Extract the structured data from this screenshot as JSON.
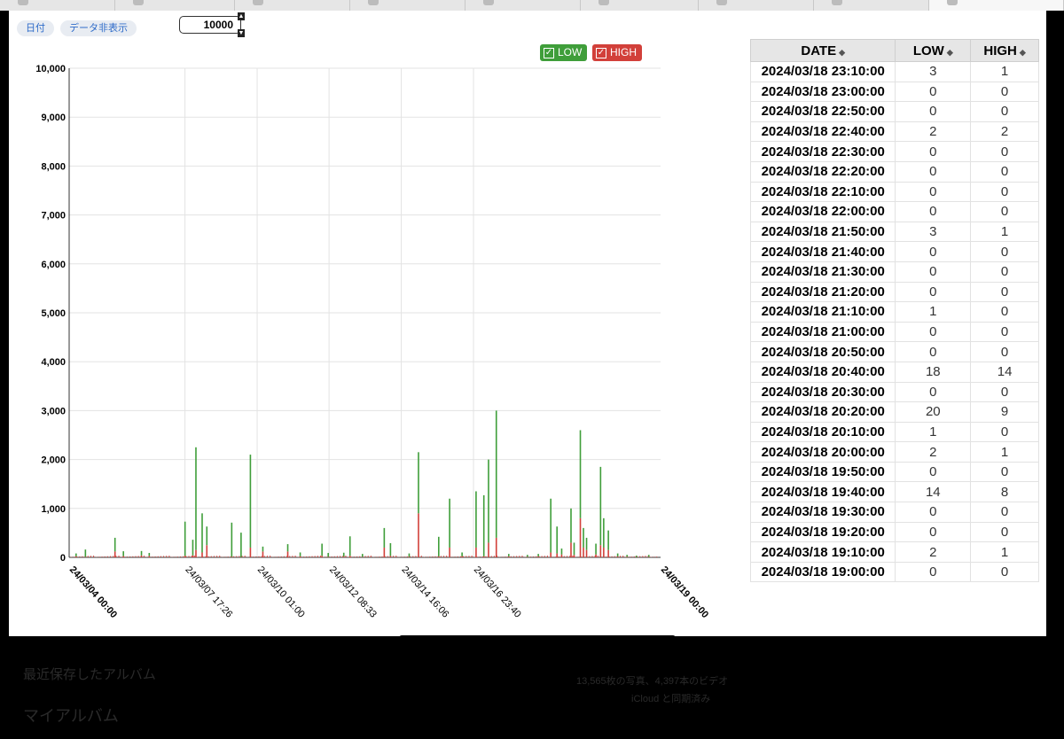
{
  "toolbar": {
    "date_button": "日付",
    "hide_data_button": "データ非表示",
    "max_value": "10000",
    "spin_up": "▲",
    "spin_down": "▼"
  },
  "legend": {
    "low_label": "LOW",
    "high_label": "HIGH",
    "low_color": "#3f9e3a",
    "high_color": "#d2403a",
    "check_glyph": "✓"
  },
  "chart_data": {
    "type": "bar",
    "stacked": true,
    "ylim": [
      0,
      10000
    ],
    "yticks": [
      "0",
      "1,000",
      "2,000",
      "3,000",
      "4,000",
      "5,000",
      "6,000",
      "7,000",
      "8,000",
      "9,000",
      "10,000"
    ],
    "xticks": [
      "24/03/04 00:00",
      "24/03/07 17:26",
      "24/03/10 01:00",
      "24/03/12 08:33",
      "24/03/14 16:06",
      "24/03/16 23:40",
      "24/03/19 00:00"
    ],
    "grid": true,
    "series": [
      {
        "name": "HIGH",
        "color": "#d2403a",
        "x": [
          0.2,
          0.5,
          1.45,
          1.72,
          2.3,
          2.55,
          3.7,
          3.95,
          4.05,
          4.25,
          4.4,
          5.2,
          5.5,
          5.8,
          6.2,
          7.0,
          7.4,
          8.1,
          8.3,
          8.8,
          9.0,
          9.4,
          10.1,
          10.3,
          10.9,
          11.2,
          11.85,
          12.2,
          12.6,
          13.05,
          13.3,
          13.45,
          13.7,
          14.1,
          14.7,
          15.05,
          15.45,
          15.65,
          15.8,
          16.1,
          16.2,
          16.4,
          16.5,
          16.6,
          16.9,
          17.05,
          17.15,
          17.3,
          17.6,
          17.9,
          18.2,
          18.6
        ],
        "y": [
          20,
          10,
          120,
          25,
          40,
          30,
          30,
          40,
          150,
          100,
          250,
          10,
          5,
          200,
          120,
          120,
          20,
          30,
          10,
          15,
          30,
          10,
          200,
          30,
          10,
          900,
          20,
          200,
          20,
          200,
          20,
          300,
          400,
          20,
          10,
          20,
          100,
          80,
          60,
          300,
          50,
          800,
          200,
          150,
          60,
          250,
          200,
          150,
          20,
          10,
          5,
          10
        ]
      },
      {
        "name": "LOW",
        "color": "#3f9e3a",
        "x": [
          0.2,
          0.5,
          1.45,
          1.72,
          2.3,
          2.55,
          3.7,
          3.95,
          4.05,
          4.25,
          4.4,
          5.2,
          5.5,
          5.8,
          6.2,
          7.0,
          7.4,
          8.1,
          8.3,
          8.8,
          9.0,
          9.4,
          10.1,
          10.3,
          10.9,
          11.2,
          11.85,
          12.2,
          12.6,
          13.05,
          13.3,
          13.45,
          13.7,
          14.1,
          14.7,
          15.05,
          15.45,
          15.65,
          15.8,
          16.1,
          16.2,
          16.4,
          16.5,
          16.6,
          16.9,
          17.05,
          17.15,
          17.3,
          17.6,
          17.9,
          18.2,
          18.6
        ],
        "y": [
          60,
          150,
          280,
          100,
          90,
          60,
          700,
          320,
          2100,
          800,
          380,
          700,
          500,
          1900,
          100,
          150,
          80,
          250,
          80,
          80,
          400,
          60,
          400,
          260,
          70,
          1250,
          400,
          1000,
          80,
          1150,
          1250,
          1700,
          2600,
          50,
          40,
          50,
          1100,
          550,
          120,
          700,
          250,
          1800,
          400,
          250,
          220,
          1600,
          600,
          400,
          60,
          40,
          30,
          40
        ]
      }
    ]
  },
  "table": {
    "headers": [
      "DATE",
      "LOW",
      "HIGH"
    ],
    "sort_glyph": "◆",
    "rows": [
      [
        "2024/03/18 23:10:00",
        "3",
        "1"
      ],
      [
        "2024/03/18 23:00:00",
        "0",
        "0"
      ],
      [
        "2024/03/18 22:50:00",
        "0",
        "0"
      ],
      [
        "2024/03/18 22:40:00",
        "2",
        "2"
      ],
      [
        "2024/03/18 22:30:00",
        "0",
        "0"
      ],
      [
        "2024/03/18 22:20:00",
        "0",
        "0"
      ],
      [
        "2024/03/18 22:10:00",
        "0",
        "0"
      ],
      [
        "2024/03/18 22:00:00",
        "0",
        "0"
      ],
      [
        "2024/03/18 21:50:00",
        "3",
        "1"
      ],
      [
        "2024/03/18 21:40:00",
        "0",
        "0"
      ],
      [
        "2024/03/18 21:30:00",
        "0",
        "0"
      ],
      [
        "2024/03/18 21:20:00",
        "0",
        "0"
      ],
      [
        "2024/03/18 21:10:00",
        "1",
        "0"
      ],
      [
        "2024/03/18 21:00:00",
        "0",
        "0"
      ],
      [
        "2024/03/18 20:50:00",
        "0",
        "0"
      ],
      [
        "2024/03/18 20:40:00",
        "18",
        "14"
      ],
      [
        "2024/03/18 20:30:00",
        "0",
        "0"
      ],
      [
        "2024/03/18 20:20:00",
        "20",
        "9"
      ],
      [
        "2024/03/18 20:10:00",
        "1",
        "0"
      ],
      [
        "2024/03/18 20:00:00",
        "2",
        "1"
      ],
      [
        "2024/03/18 19:50:00",
        "0",
        "0"
      ],
      [
        "2024/03/18 19:40:00",
        "14",
        "8"
      ],
      [
        "2024/03/18 19:30:00",
        "0",
        "0"
      ],
      [
        "2024/03/18 19:20:00",
        "0",
        "0"
      ],
      [
        "2024/03/18 19:10:00",
        "2",
        "1"
      ],
      [
        "2024/03/18 19:00:00",
        "0",
        "0"
      ]
    ]
  },
  "background": {
    "album1": "最近保存したアルバム",
    "album2": "マイアルバム",
    "counts": "13,565枚の写真、4,397本のビデオ",
    "cloud_status": "iCloud と同期済み"
  }
}
